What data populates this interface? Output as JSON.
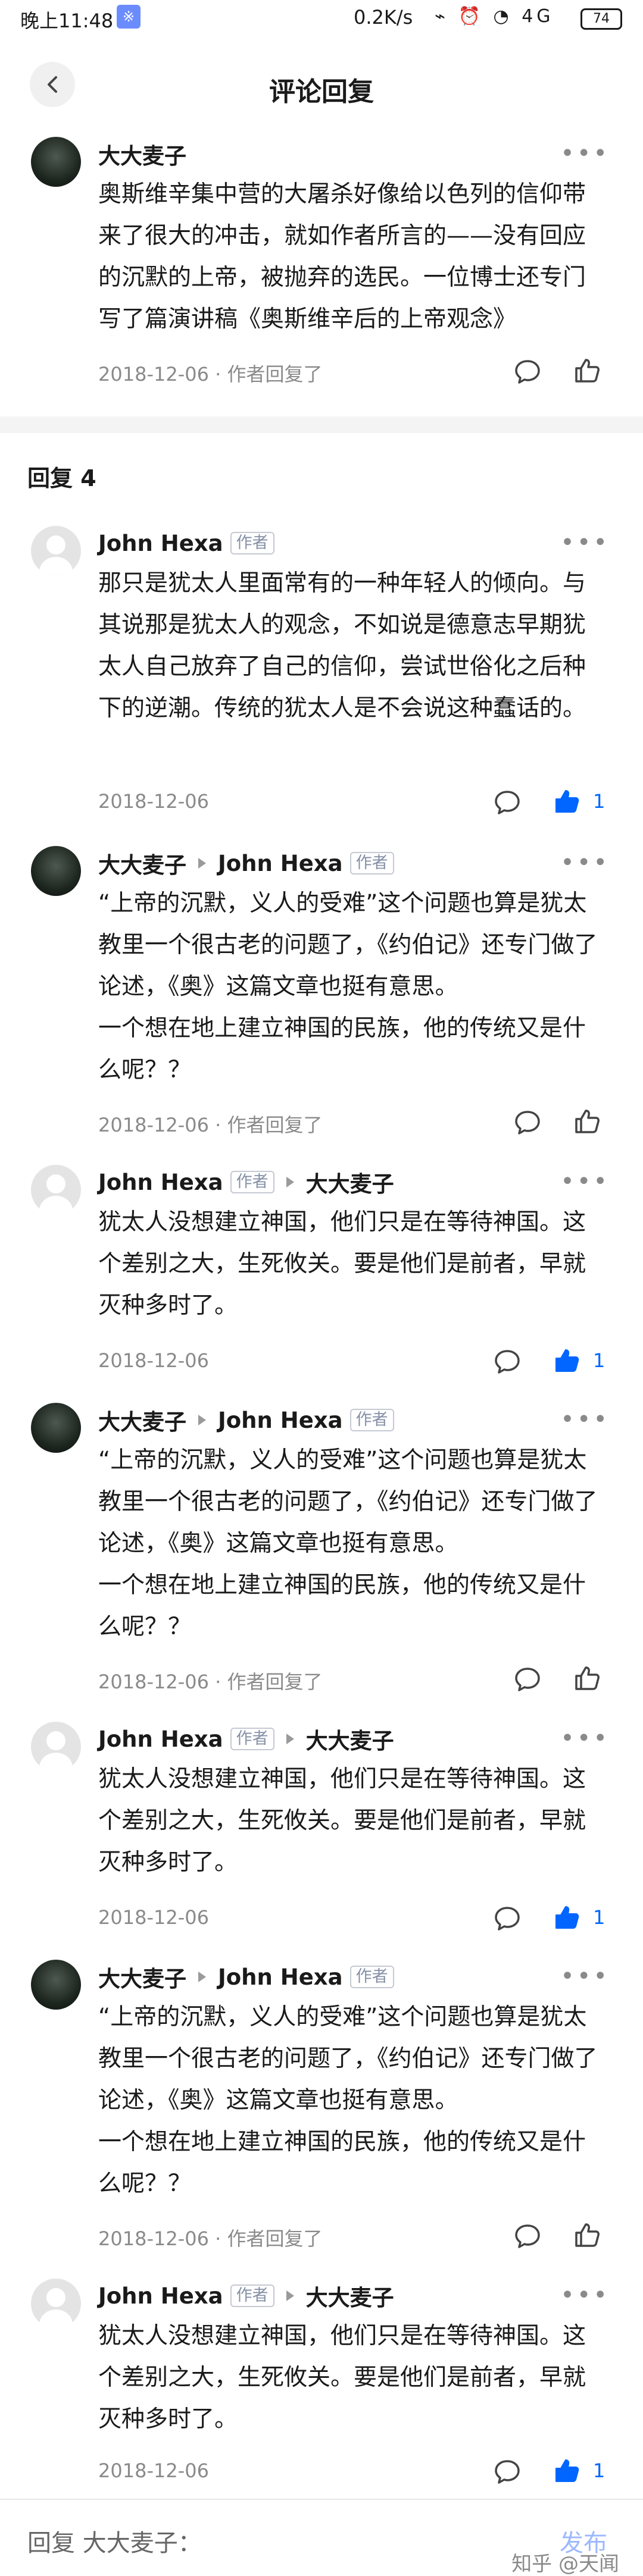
{
  "status_bar": {
    "time": "晚上11:48",
    "net_badge": "※",
    "speed": "0.2K/s",
    "icons": "⌁ ⏰ ◔ 4G",
    "battery": "74"
  },
  "header": {
    "title": "评论回复"
  },
  "top_comment": {
    "author": "大大麦子",
    "text": "奥斯维辛集中营的大屠杀好像给以色列的信仰带来了很大的冲击，就如作者所言的——没有回应的沉默的上帝，被抛弃的选民。一位博士还专门写了篇演讲稿《奥斯维辛后的上帝观念》",
    "meta": "2018-12-06 · 作者回复了"
  },
  "replies_header": "回复 4",
  "replies": [
    {
      "author": "John Hexa",
      "author_tag": "作者",
      "text": "那只是犹太人里面常有的一种年轻人的倾向。与其说那是犹太人的观念，不如说是德意志早期犹太人自己放弃了自己的信仰，尝试世俗化之后种下的逆潮。传统的犹太人是不会说这种蠢话的。",
      "meta": "2018-12-06",
      "like_count": "1"
    },
    {
      "author": "大大麦子",
      "reply_to": "John Hexa",
      "reply_to_tag": "作者",
      "text": "“上帝的沉默，义人的受难”这个问题也算是犹太教里一个很古老的问题了，《约伯记》还专门做了论述，《奥》这篇文章也挺有意思。\n一个想在地上建立神国的民族，他的传统又是什么呢？？",
      "meta": "2018-12-06 · 作者回复了"
    },
    {
      "author": "John Hexa",
      "author_tag": "作者",
      "reply_to": "大大麦子",
      "text": "犹太人没想建立神国，他们只是在等待神国。这个差别之大，生死攸关。要是他们是前者，早就灭种多时了。",
      "meta": "2018-12-06",
      "like_count": "1"
    },
    {
      "author": "大大麦子",
      "reply_to": "John Hexa",
      "reply_to_tag": "作者",
      "text": "“上帝的沉默，义人的受难”这个问题也算是犹太教里一个很古老的问题了，《约伯记》还专门做了论述，《奥》这篇文章也挺有意思。\n一个想在地上建立神国的民族，他的传统又是什么呢？？",
      "meta": "2018-12-06 · 作者回复了"
    },
    {
      "author": "John Hexa",
      "author_tag": "作者",
      "reply_to": "大大麦子",
      "text": "犹太人没想建立神国，他们只是在等待神国。这个差别之大，生死攸关。要是他们是前者，早就灭种多时了。",
      "meta": "2018-12-06",
      "like_count": "1"
    },
    {
      "author": "大大麦子",
      "reply_to": "John Hexa",
      "reply_to_tag": "作者",
      "text": "“上帝的沉默，义人的受难”这个问题也算是犹太教里一个很古老的问题了，《约伯记》还专门做了论述，《奥》这篇文章也挺有意思。\n一个想在地上建立神国的民族，他的传统又是什么呢？？",
      "meta": "2018-12-06 · 作者回复了"
    },
    {
      "author": "John Hexa",
      "author_tag": "作者",
      "reply_to": "大大麦子",
      "text": "犹太人没想建立神国，他们只是在等待神国。这个差别之大，生死攸关。要是他们是前者，早就灭种多时了。",
      "meta": "2018-12-06",
      "like_count": "1"
    }
  ],
  "reply_bar": {
    "placeholder": "回复 大大麦子：",
    "publish": "发布",
    "watermark": "知乎 @天闻"
  },
  "colors": {
    "accent": "#0066ff",
    "muted": "#8a8a8a",
    "tag_border": "#c5c9d2"
  }
}
